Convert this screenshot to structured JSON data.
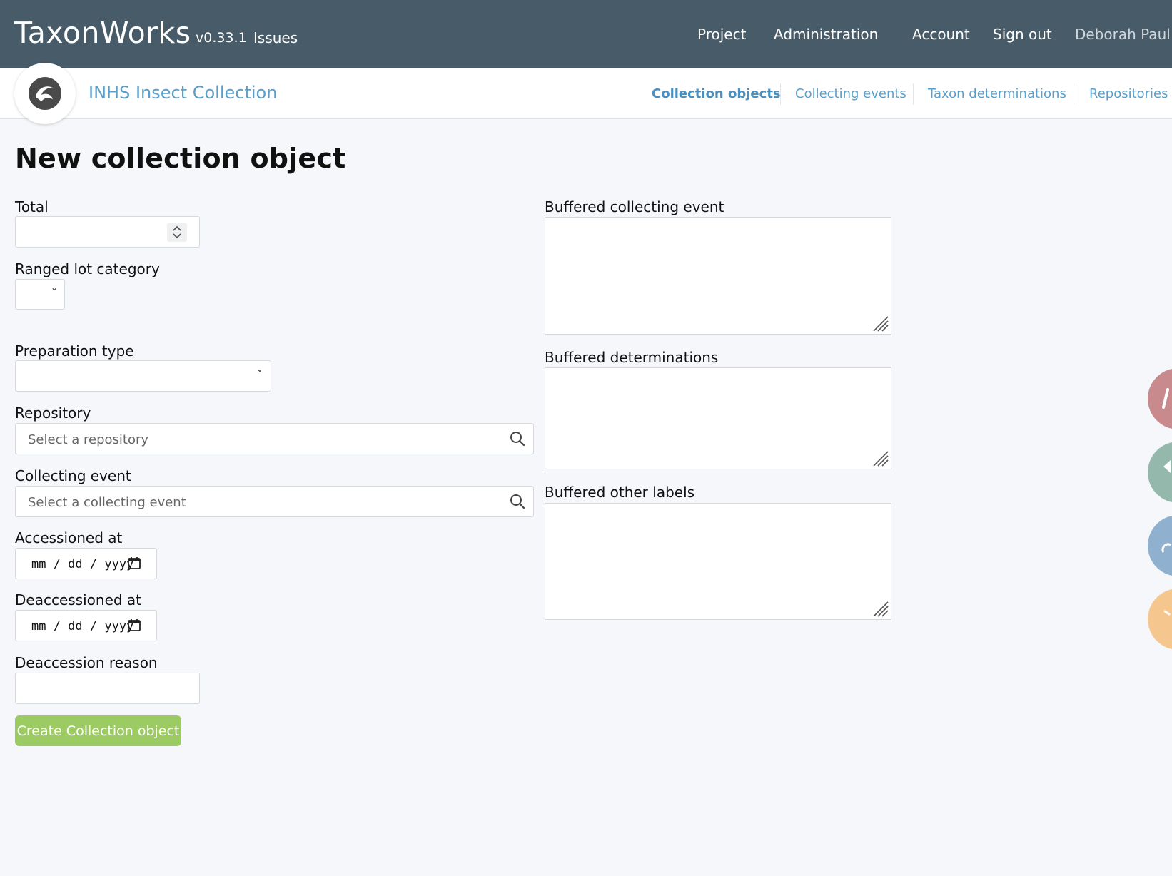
{
  "header": {
    "brand": "TaxonWorks",
    "version": "v0.33.1",
    "issues_link": "Issues",
    "nav": [
      "Project",
      "Administration",
      "Account",
      "Sign out"
    ],
    "user": "Deborah Paul"
  },
  "subheader": {
    "project_name": "INHS Insect Collection",
    "tabs": [
      "Collection objects",
      "Collecting events",
      "Taxon determinations",
      "Repositories"
    ],
    "active_tab": "Collection objects"
  },
  "page": {
    "title": "New collection object"
  },
  "form": {
    "total_label": "Total",
    "total_value": "",
    "ranged_lot_label": "Ranged lot category",
    "ranged_lot_value": "",
    "preparation_type_label": "Preparation type",
    "preparation_type_value": "",
    "repository_label": "Repository",
    "repository_placeholder": "Select a repository",
    "collecting_event_label": "Collecting event",
    "collecting_event_placeholder": "Select a collecting event",
    "accessioned_label": "Accessioned at",
    "accessioned_value": "mm / dd / yyyy",
    "deaccessioned_label": "Deaccessioned at",
    "deaccessioned_value": "mm / dd / yyyy",
    "deaccession_reason_label": "Deaccession reason",
    "deaccession_reason_value": "",
    "buffered_collecting_event_label": "Buffered collecting event",
    "buffered_determinations_label": "Buffered determinations",
    "buffered_other_labels_label": "Buffered other labels",
    "submit_label": "Create Collection object"
  },
  "side_buttons": [
    {
      "name": "side-action-1",
      "color": "#c98a8e"
    },
    {
      "name": "side-action-2",
      "color": "#95b8ac"
    },
    {
      "name": "side-action-3",
      "color": "#8fb1cf"
    },
    {
      "name": "side-action-4",
      "color": "#f6c68f"
    }
  ]
}
